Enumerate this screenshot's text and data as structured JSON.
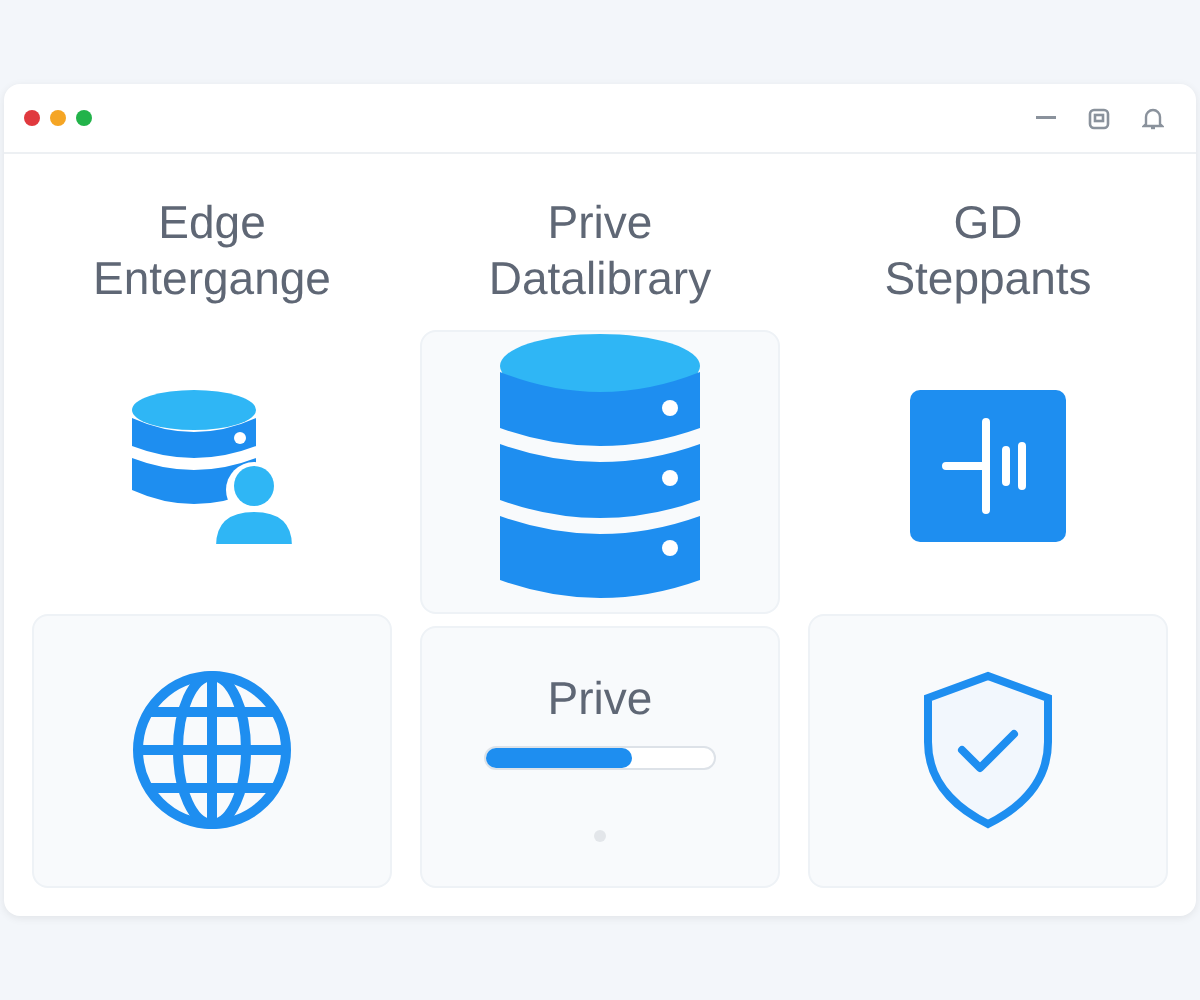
{
  "window": {
    "controls": [
      {
        "color": "#e0393e"
      },
      {
        "color": "#f5a524"
      },
      {
        "color": "#22b34a"
      }
    ]
  },
  "columns": [
    {
      "title": "Edge Entergange",
      "tiles": [
        {
          "kind": "userdb",
          "card": false
        },
        {
          "kind": "globe",
          "card": true
        }
      ]
    },
    {
      "title": "Prive Datalibrary",
      "tiles": [
        {
          "kind": "database",
          "card": true
        },
        {
          "kind": "progress",
          "label": "Prive",
          "level": 0.64,
          "card": true
        }
      ]
    },
    {
      "title": "GD Steppants",
      "tiles": [
        {
          "kind": "audio",
          "card": false
        },
        {
          "kind": "shield",
          "card": true
        }
      ]
    }
  ]
}
